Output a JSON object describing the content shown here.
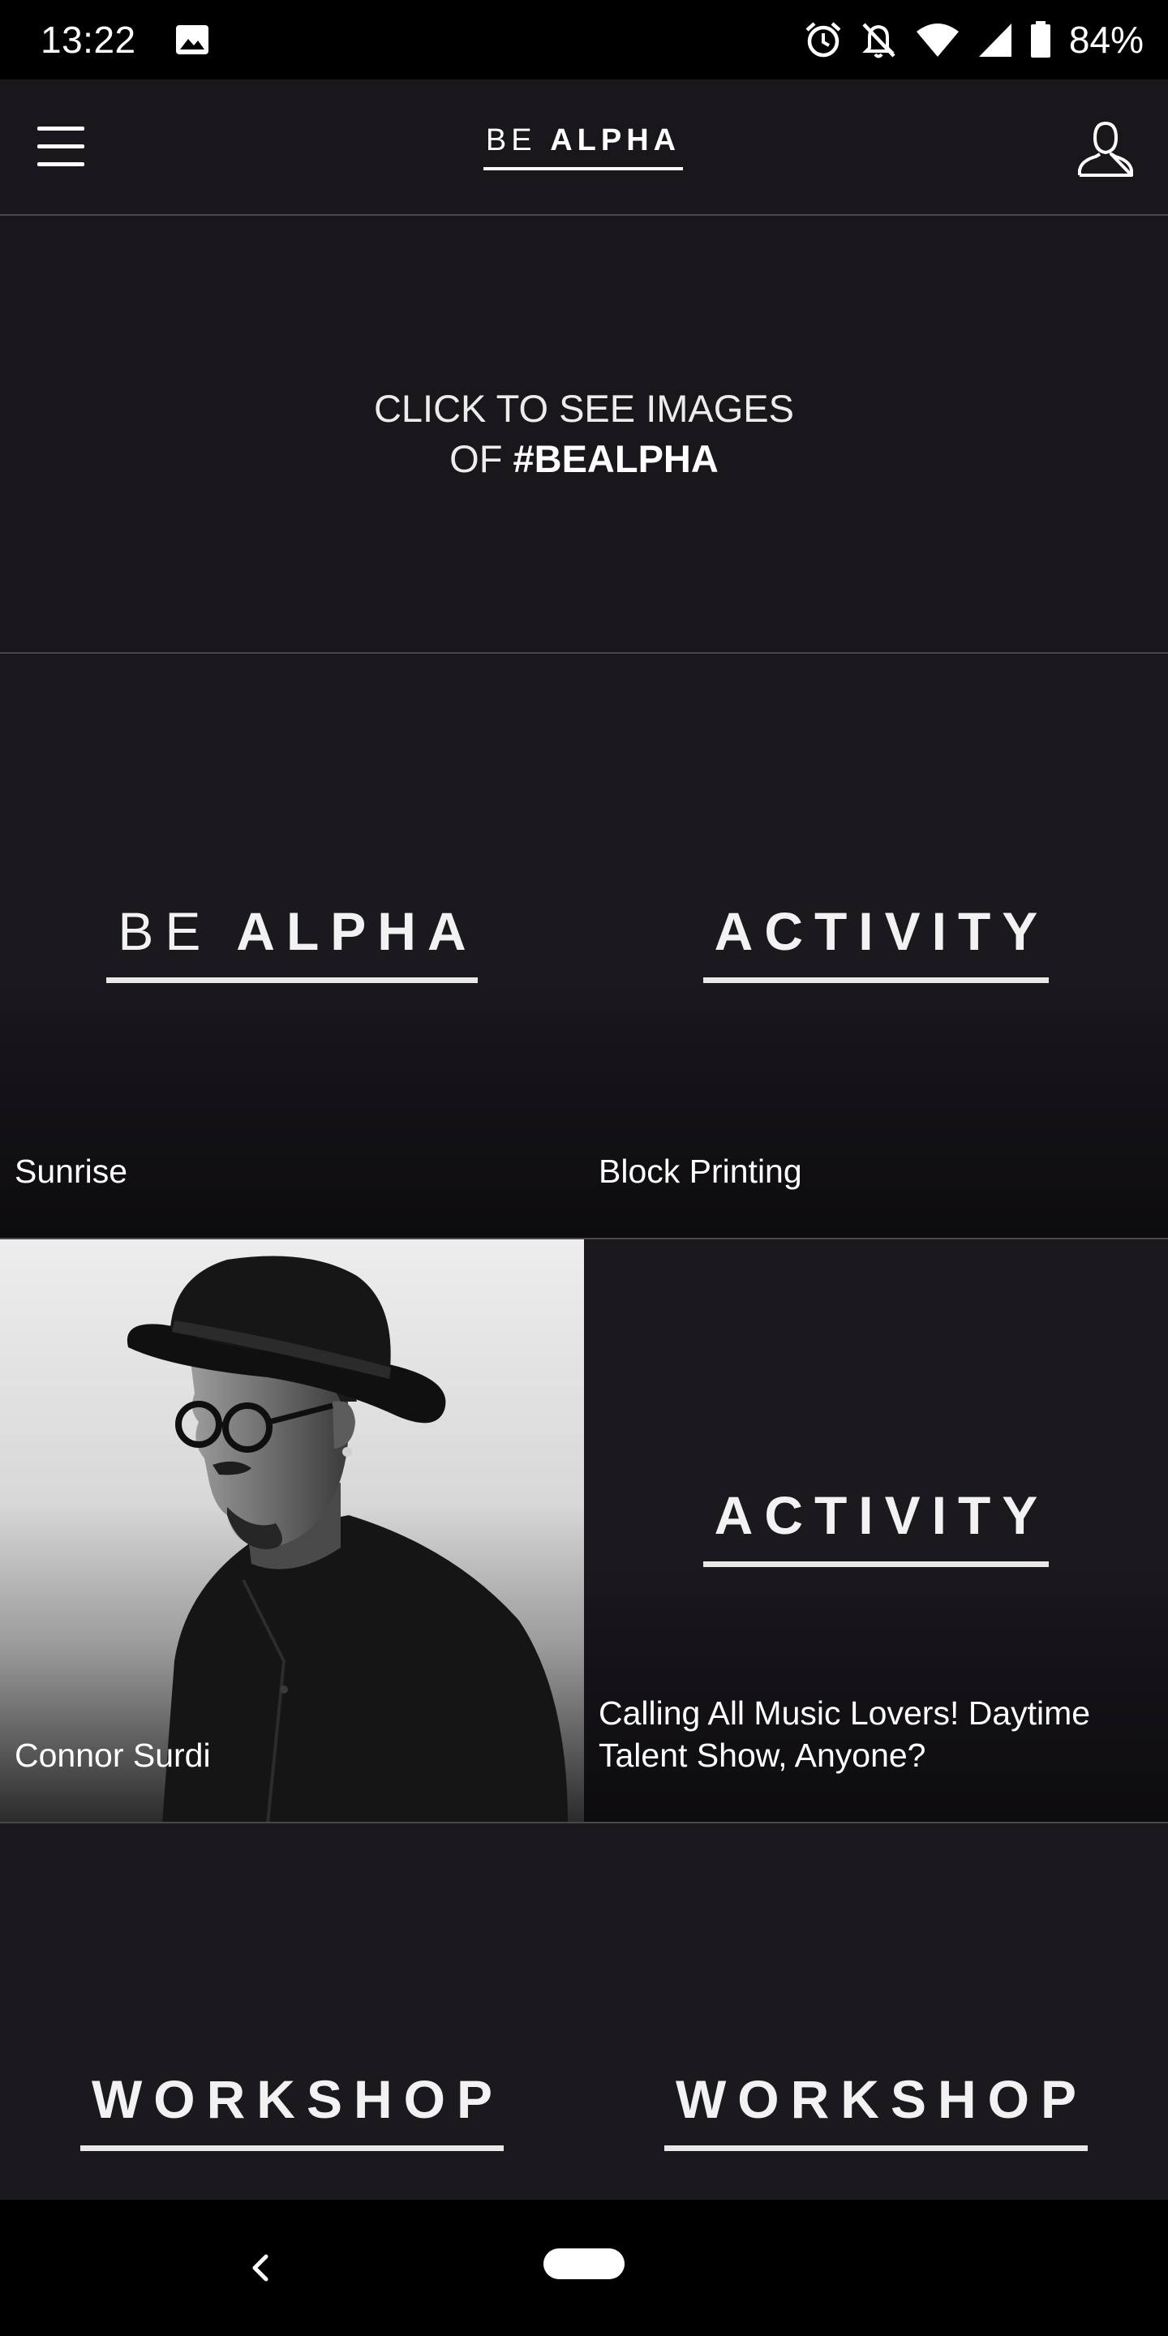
{
  "status_bar": {
    "time": "13:22",
    "battery": "84%",
    "icons": [
      "image-icon",
      "alarm-icon",
      "bell-off-icon",
      "wifi-icon",
      "signal-icon",
      "battery-icon"
    ]
  },
  "header": {
    "logo_be": "BE",
    "logo_alpha": "ALPHA",
    "menu_icon": "hamburger-menu-icon",
    "profile_icon": "user-profile-icon"
  },
  "banner": {
    "line1": "CLICK TO SEE IMAGES",
    "line2_prefix": "OF ",
    "line2_bold": "#BEALPHA"
  },
  "tiles": [
    {
      "badge_be": "BE",
      "badge_main": "ALPHA",
      "caption": "Sunrise"
    },
    {
      "badge_main": "ACTIVITY",
      "caption": "Block Printing"
    },
    {
      "caption": "Connor Surdi",
      "image": "black-and-white portrait of man in hat and glasses"
    },
    {
      "badge_main": "ACTIVITY",
      "caption": "Calling All Music Lovers! Daytime Talent Show, Anyone?"
    },
    {
      "badge_main": "WORKSHOP"
    },
    {
      "badge_main": "WORKSHOP"
    }
  ],
  "nav_bar": {
    "back_icon": "back-chevron-icon",
    "home_icon": "home-pill-icon"
  },
  "colors": {
    "background": "#19161c",
    "status_bar": "#000000",
    "divider": "#4a464e",
    "text": "#ffffff"
  }
}
